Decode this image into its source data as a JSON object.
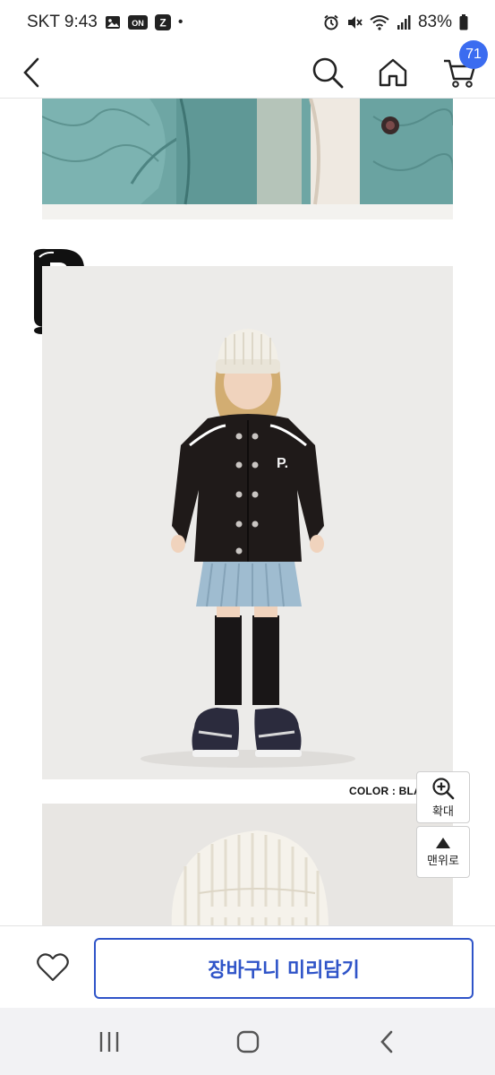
{
  "status_bar": {
    "carrier_time": "SKT 9:43",
    "badge_on": "ON",
    "badge_z": "Z",
    "dot": "•",
    "battery": "83%"
  },
  "header": {
    "cart_count": "71"
  },
  "product": {
    "color_label": "COLOR : BLACK"
  },
  "floating": {
    "zoom_label": "확대",
    "top_label": "맨위로"
  },
  "action_bar": {
    "add_to_cart_label": "장바구니 미리담기"
  },
  "colors": {
    "accent": "#2f54c8",
    "badge": "#3b6cf0"
  },
  "icons": [
    "gallery-icon",
    "alarm-icon",
    "mute-icon",
    "wifi-icon",
    "signal-icon",
    "battery-icon",
    "back-arrow-icon",
    "search-icon",
    "home-icon",
    "cart-icon",
    "zoom-in-icon",
    "arrow-up-icon",
    "heart-icon",
    "recent-apps-icon",
    "home-circle-icon",
    "chevron-left-icon"
  ]
}
